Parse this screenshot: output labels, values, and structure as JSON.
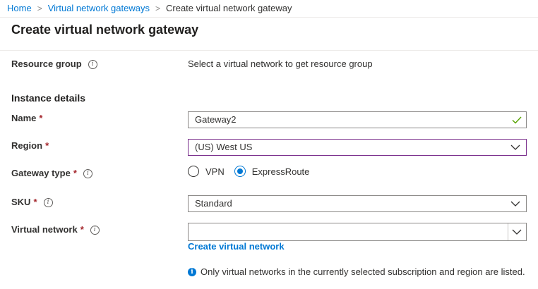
{
  "breadcrumb": {
    "items": [
      "Home",
      "Virtual network gateways",
      "Create virtual network gateway"
    ],
    "separator": ">"
  },
  "page_title": "Create virtual network gateway",
  "resource_group": {
    "label": "Resource group",
    "value": "Select a virtual network to get resource group"
  },
  "instance_details": {
    "heading": "Instance details"
  },
  "fields": {
    "name": {
      "label": "Name",
      "required": "*",
      "value": "Gateway2"
    },
    "region": {
      "label": "Region",
      "required": "*",
      "value": "(US) West US"
    },
    "gateway_type": {
      "label": "Gateway type",
      "required": "*",
      "options": [
        "VPN",
        "ExpressRoute"
      ],
      "selected": "ExpressRoute"
    },
    "sku": {
      "label": "SKU",
      "required": "*",
      "value": "Standard"
    },
    "virtual_network": {
      "label": "Virtual network",
      "required": "*",
      "value": "",
      "create_link": "Create virtual network",
      "note": "Only virtual networks in the currently selected subscription and region are listed."
    }
  },
  "icons": {
    "info": "info-icon",
    "valid": "checkmark-icon",
    "dropdown": "chevron-down-icon",
    "note": "info-filled-icon"
  },
  "colors": {
    "accent": "#0078d4",
    "required": "#a4262c",
    "valid": "#57a300",
    "focus_border": "#7a2f8c"
  }
}
